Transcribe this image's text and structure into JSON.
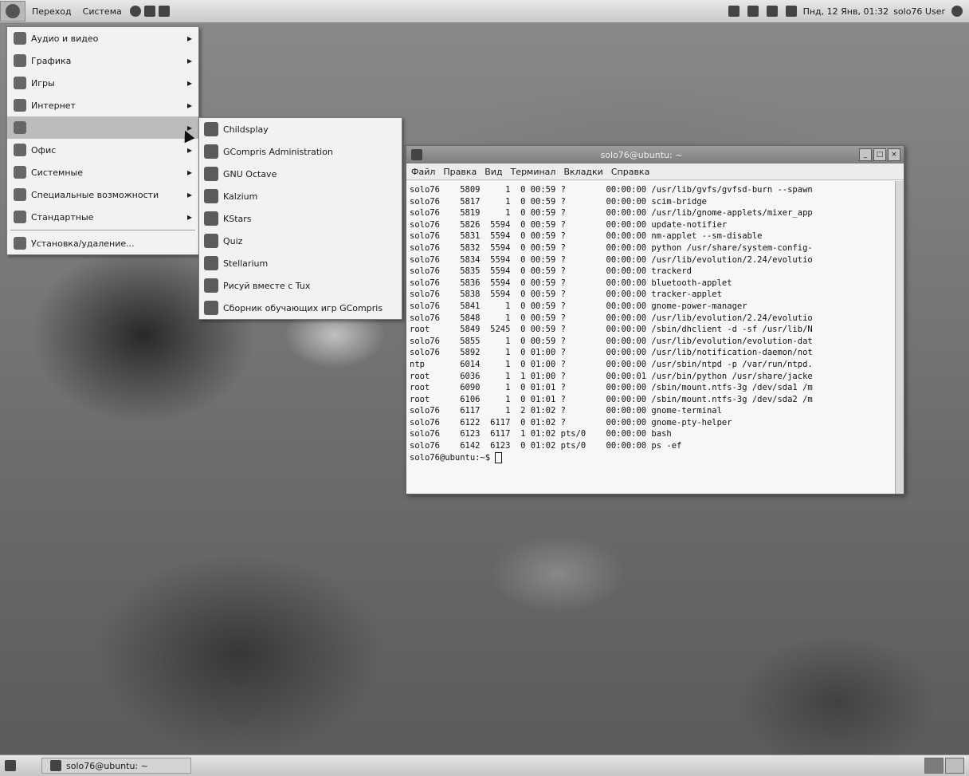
{
  "top_panel": {
    "menus": [
      "Переход",
      "Система"
    ],
    "clock": "Пнд, 12 Янв, 01:32",
    "user": "solo76 User"
  },
  "apps_menu": {
    "items": [
      {
        "label": "Аудио и видео",
        "icon": "audio-video-icon",
        "submenu": true
      },
      {
        "label": "Графика",
        "icon": "graphics-icon",
        "submenu": true
      },
      {
        "label": "Игры",
        "icon": "games-icon",
        "submenu": true
      },
      {
        "label": "Интернет",
        "icon": "internet-icon",
        "submenu": true
      },
      {
        "label": "",
        "icon": "education-icon",
        "submenu": true
      },
      {
        "label": "Офис",
        "icon": "office-icon",
        "submenu": true
      },
      {
        "label": "Системные",
        "icon": "system-tools-icon",
        "submenu": true
      },
      {
        "label": "Специальные возможности",
        "icon": "accessibility-icon",
        "submenu": true
      },
      {
        "label": "Стандартные",
        "icon": "accessories-icon",
        "submenu": true
      },
      {
        "label": "Установка/удаление...",
        "icon": "add-remove-icon",
        "submenu": false
      }
    ],
    "selected_index": 4
  },
  "sub_menu": {
    "items": [
      {
        "label": "Childsplay",
        "icon": "childsplay-icon"
      },
      {
        "label": "GCompris Administration",
        "icon": "gcompris-admin-icon"
      },
      {
        "label": "GNU Octave",
        "icon": "octave-icon"
      },
      {
        "label": "Kalzium",
        "icon": "kalzium-icon"
      },
      {
        "label": "KStars",
        "icon": "kstars-icon"
      },
      {
        "label": "Quiz",
        "icon": "quiz-icon"
      },
      {
        "label": "Stellarium",
        "icon": "stellarium-icon"
      },
      {
        "label": "Рисуй вместе с Tux",
        "icon": "tuxpaint-icon"
      },
      {
        "label": "Сборник обучающих игр GCompris",
        "icon": "gcompris-icon"
      }
    ]
  },
  "terminal": {
    "title": "solo76@ubuntu: ~",
    "menu": [
      "Файл",
      "Правка",
      "Вид",
      "Терминал",
      "Вкладки",
      "Справка"
    ],
    "lines": [
      "solo76    5809     1  0 00:59 ?        00:00:00 /usr/lib/gvfs/gvfsd-burn --spawn",
      "solo76    5817     1  0 00:59 ?        00:00:00 scim-bridge",
      "solo76    5819     1  0 00:59 ?        00:00:00 /usr/lib/gnome-applets/mixer_app",
      "solo76    5826  5594  0 00:59 ?        00:00:00 update-notifier",
      "solo76    5831  5594  0 00:59 ?        00:00:00 nm-applet --sm-disable",
      "solo76    5832  5594  0 00:59 ?        00:00:00 python /usr/share/system-config-",
      "solo76    5834  5594  0 00:59 ?        00:00:00 /usr/lib/evolution/2.24/evolutio",
      "solo76    5835  5594  0 00:59 ?        00:00:00 trackerd",
      "solo76    5836  5594  0 00:59 ?        00:00:00 bluetooth-applet",
      "solo76    5838  5594  0 00:59 ?        00:00:00 tracker-applet",
      "solo76    5841     1  0 00:59 ?        00:00:00 gnome-power-manager",
      "solo76    5848     1  0 00:59 ?        00:00:00 /usr/lib/evolution/2.24/evolutio",
      "root      5849  5245  0 00:59 ?        00:00:00 /sbin/dhclient -d -sf /usr/lib/N",
      "solo76    5855     1  0 00:59 ?        00:00:00 /usr/lib/evolution/evolution-dat",
      "solo76    5892     1  0 01:00 ?        00:00:00 /usr/lib/notification-daemon/not",
      "ntp       6014     1  0 01:00 ?        00:00:00 /usr/sbin/ntpd -p /var/run/ntpd.",
      "root      6036     1  1 01:00 ?        00:00:01 /usr/bin/python /usr/share/jacke",
      "root      6090     1  0 01:01 ?        00:00:00 /sbin/mount.ntfs-3g /dev/sda1 /m",
      "root      6106     1  0 01:01 ?        00:00:00 /sbin/mount.ntfs-3g /dev/sda2 /m",
      "solo76    6117     1  2 01:02 ?        00:00:00 gnome-terminal",
      "solo76    6122  6117  0 01:02 ?        00:00:00 gnome-pty-helper",
      "solo76    6123  6117  1 01:02 pts/0    00:00:00 bash",
      "solo76    6142  6123  0 01:02 pts/0    00:00:00 ps -ef"
    ],
    "prompt": "solo76@ubuntu:~$ "
  },
  "bottom_panel": {
    "task_label": "solo76@ubuntu: ~"
  }
}
